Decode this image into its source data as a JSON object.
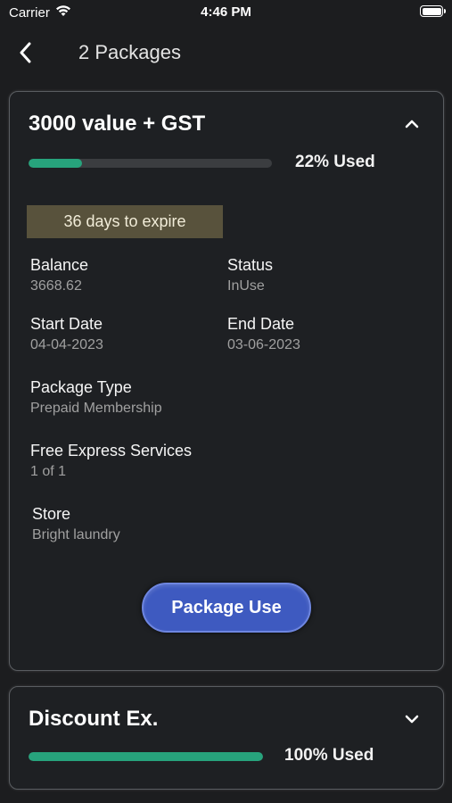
{
  "status_bar": {
    "carrier": "Carrier",
    "time": "4:46 PM"
  },
  "nav": {
    "title": "2 Packages"
  },
  "packages": [
    {
      "title": "3000 value + GST",
      "used_percent": 22,
      "used_label": "22% Used",
      "expire_label": "36 days to expire",
      "balance_label": "Balance",
      "balance": "3668.62",
      "status_label": "Status",
      "status": "InUse",
      "start_date_label": "Start Date",
      "start_date": "04-04-2023",
      "end_date_label": "End Date",
      "end_date": "03-06-2023",
      "package_type_label": "Package Type",
      "package_type": "Prepaid Membership",
      "free_express_label": "Free Express Services",
      "free_express": "1 of 1",
      "store_label": "Store",
      "store": "Bright laundry",
      "button_label": "Package Use",
      "expanded": true
    },
    {
      "title": "Discount Ex.",
      "used_percent": 100,
      "used_label": "100% Used",
      "expanded": false
    }
  ],
  "colors": {
    "background": "#1c1d1f",
    "card": "#1e2023",
    "progress_fill": "#27a37c",
    "badge_bg": "#58523c",
    "button": "#3e5ac0"
  }
}
